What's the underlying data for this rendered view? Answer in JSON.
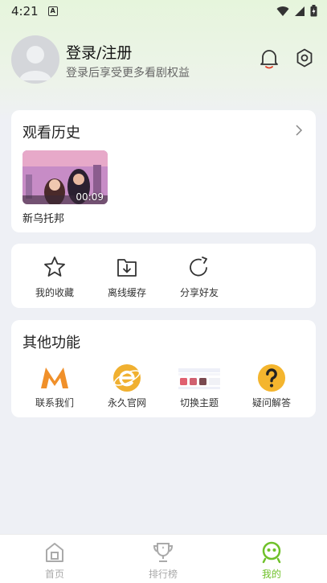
{
  "status_bar": {
    "time": "4:21",
    "a_badge": "A"
  },
  "profile": {
    "title": "登录/注册",
    "subtitle": "登录后享受更多看剧权益"
  },
  "history": {
    "title": "观看历史",
    "items": [
      {
        "name": "新乌托邦",
        "duration": "00:09"
      }
    ]
  },
  "actions": [
    {
      "label": "我的收藏",
      "icon": "star-icon"
    },
    {
      "label": "离线缓存",
      "icon": "download-folder-icon"
    },
    {
      "label": "分享好友",
      "icon": "share-refresh-icon"
    }
  ],
  "other": {
    "title": "其他功能",
    "items": [
      {
        "label": "联系我们",
        "icon": "m-logo-icon"
      },
      {
        "label": "永久官网",
        "icon": "e-browser-icon"
      },
      {
        "label": "切换主题",
        "icon": "theme-palette-icon"
      },
      {
        "label": "疑问解答",
        "icon": "question-icon"
      }
    ]
  },
  "tabs": [
    {
      "label": "首页",
      "icon": "home-icon",
      "active": false
    },
    {
      "label": "排行榜",
      "icon": "trophy-icon",
      "active": false
    },
    {
      "label": "我的",
      "icon": "mine-icon",
      "active": true
    }
  ],
  "colors": {
    "accent": "#6fc12a",
    "orange": "#f0902a",
    "help_yellow": "#f4b52e"
  }
}
